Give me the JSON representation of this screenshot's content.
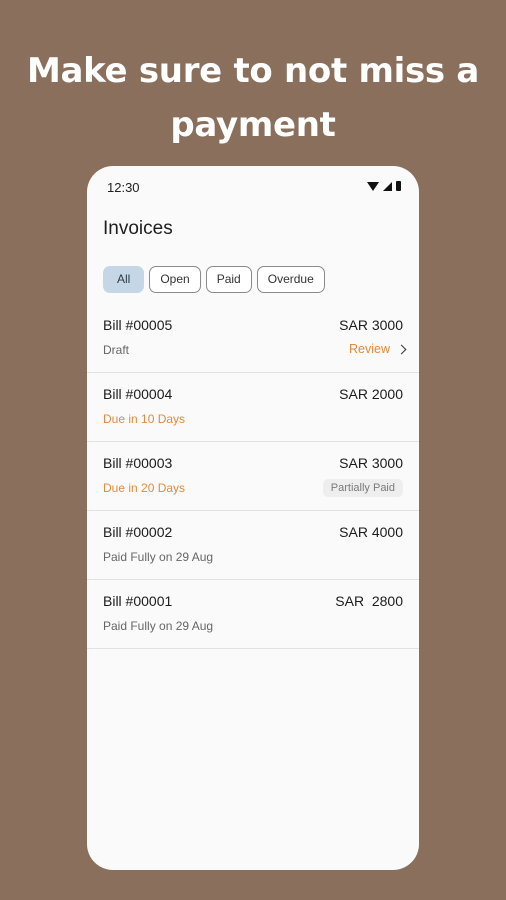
{
  "headline": {
    "line1": "Make sure to not miss a",
    "line2": "payment"
  },
  "status_bar": {
    "time": "12:30"
  },
  "screen": {
    "title": "Invoices"
  },
  "filters": [
    {
      "label": "All",
      "active": true
    },
    {
      "label": "Open",
      "active": false
    },
    {
      "label": "Paid",
      "active": false
    },
    {
      "label": "Overdue",
      "active": false
    }
  ],
  "invoices": [
    {
      "bill": "Bill #00005",
      "amount": "SAR 3000",
      "status": "Draft",
      "action": "Review"
    },
    {
      "bill": "Bill #00004",
      "amount": "SAR 2000",
      "status": "Due in 10 Days"
    },
    {
      "bill": "Bill #00003",
      "amount": "SAR 3000",
      "status": "Due in 20 Days",
      "badge": "Partially Paid"
    },
    {
      "bill": "Bill #00002",
      "amount": "SAR 4000",
      "status": "Paid Fully on 29 Aug"
    },
    {
      "bill": "Bill #00001",
      "amount": "SAR  2800",
      "status": "Paid Fully on 29 Aug"
    }
  ],
  "colors": {
    "background": "#8a705c",
    "accent_orange": "#e58a3c",
    "chip_active": "#c5d7e6"
  }
}
